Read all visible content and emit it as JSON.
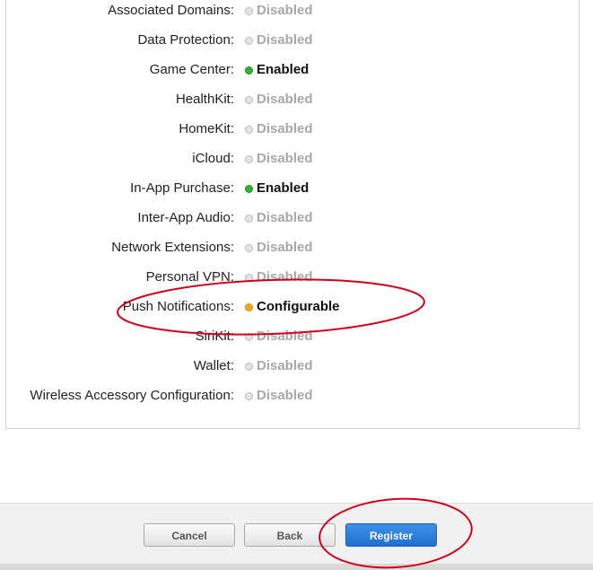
{
  "capabilities": [
    {
      "label": "Associated Domains:",
      "status": "Disabled",
      "state": "disabled"
    },
    {
      "label": "Data Protection:",
      "status": "Disabled",
      "state": "disabled"
    },
    {
      "label": "Game Center:",
      "status": "Enabled",
      "state": "enabled"
    },
    {
      "label": "HealthKit:",
      "status": "Disabled",
      "state": "disabled"
    },
    {
      "label": "HomeKit:",
      "status": "Disabled",
      "state": "disabled"
    },
    {
      "label": "iCloud:",
      "status": "Disabled",
      "state": "disabled"
    },
    {
      "label": "In-App Purchase:",
      "status": "Enabled",
      "state": "enabled"
    },
    {
      "label": "Inter-App Audio:",
      "status": "Disabled",
      "state": "disabled"
    },
    {
      "label": "Network Extensions:",
      "status": "Disabled",
      "state": "disabled"
    },
    {
      "label": "Personal VPN:",
      "status": "Disabled",
      "state": "disabled"
    },
    {
      "label": "Push Notifications:",
      "status": "Configurable",
      "state": "configurable"
    },
    {
      "label": "SiriKit:",
      "status": "Disabled",
      "state": "disabled"
    },
    {
      "label": "Wallet:",
      "status": "Disabled",
      "state": "disabled"
    },
    {
      "label": "Wireless Accessory Configuration:",
      "status": "Disabled",
      "state": "disabled"
    }
  ],
  "footer": {
    "cancel_label": "Cancel",
    "back_label": "Back",
    "register_label": "Register"
  },
  "colors": {
    "enabled": "#2bb52b",
    "configurable": "#f5a623",
    "disabled": "#b9b9b9",
    "primary_button": "#2a7fdf",
    "annotation": "#d0021b"
  }
}
